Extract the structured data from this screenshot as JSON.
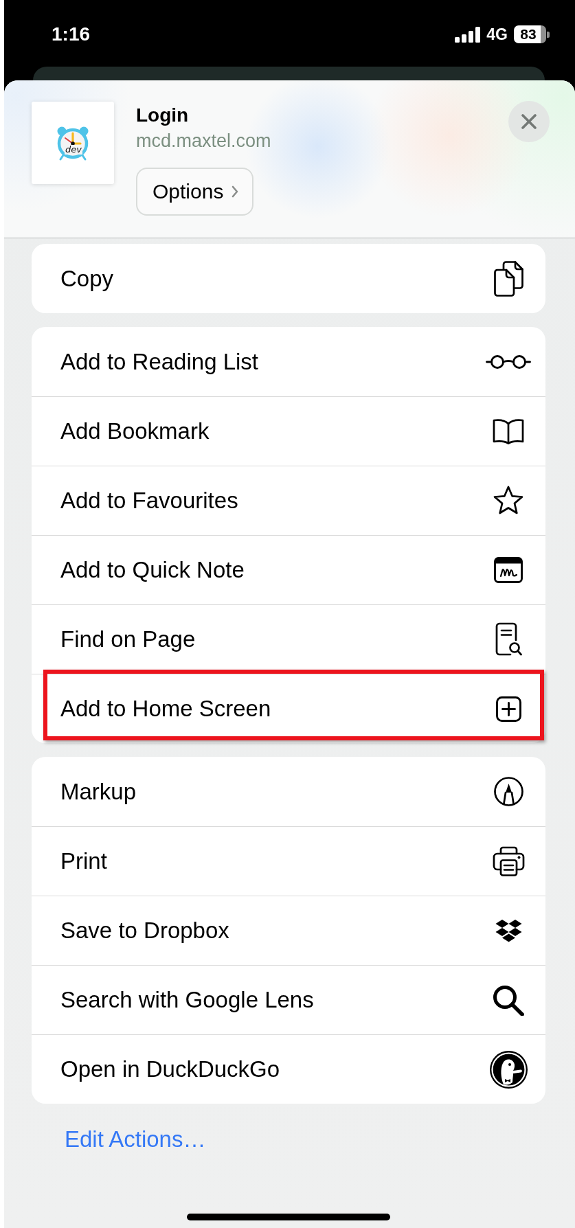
{
  "status_bar": {
    "time": "1:16",
    "network": "4G",
    "battery": "83"
  },
  "header": {
    "app_icon_label": "dev",
    "title": "Login",
    "url": "mcd.maxtel.com",
    "options_button": "Options"
  },
  "action_groups": [
    {
      "actions": [
        {
          "label": "Copy",
          "highlighted": false
        }
      ]
    },
    {
      "actions": [
        {
          "label": "Add to Reading List",
          "highlighted": false
        },
        {
          "label": "Add Bookmark",
          "highlighted": false
        },
        {
          "label": "Add to Favourites",
          "highlighted": false
        },
        {
          "label": "Add to Quick Note",
          "highlighted": false
        },
        {
          "label": "Find on Page",
          "highlighted": false
        },
        {
          "label": "Add to Home Screen",
          "highlighted": true
        }
      ]
    },
    {
      "actions": [
        {
          "label": "Markup",
          "highlighted": false
        },
        {
          "label": "Print",
          "highlighted": false
        },
        {
          "label": "Save to Dropbox",
          "highlighted": false
        },
        {
          "label": "Search with Google Lens",
          "highlighted": false
        },
        {
          "label": "Open in DuckDuckGo",
          "highlighted": false
        }
      ]
    }
  ],
  "edit_actions": "Edit Actions…"
}
